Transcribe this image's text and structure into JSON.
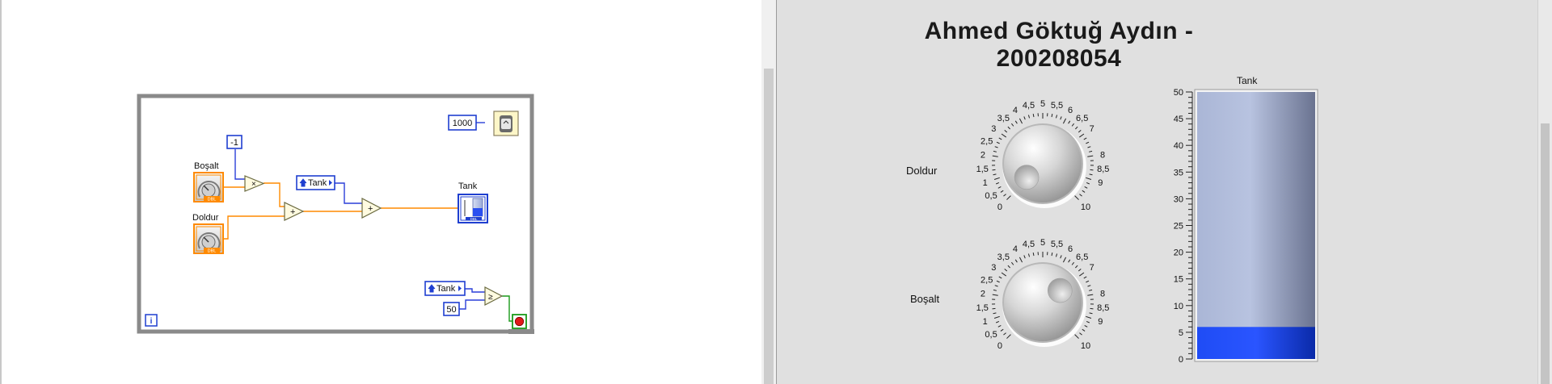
{
  "block_diagram": {
    "constants": {
      "minus_one": "-1",
      "wait_ms": "1000",
      "stop_limit": "50"
    },
    "labels": {
      "bosalt": "Boşalt",
      "doldur": "Doldur",
      "tank": "Tank"
    },
    "local_variables": {
      "tank_local_1": "Tank",
      "tank_local_2": "Tank"
    },
    "knob_terminal_type": "DBL",
    "tank_terminal_type": "DBL",
    "iteration_terminal": "i",
    "operators": {
      "multiply": "×",
      "add": "+",
      "compare": "≥"
    }
  },
  "front_panel": {
    "title": "Ahmed Göktuğ Aydın - 200208054",
    "knobs": [
      {
        "label": "Doldur",
        "ticks": [
          "0",
          "0,5",
          "1",
          "1,5",
          "2",
          "2,5",
          "3",
          "3,5",
          "4",
          "4,5",
          "5",
          "5,5",
          "6",
          "6,5",
          "7",
          "8",
          "8,5",
          "9",
          "10"
        ]
      },
      {
        "label": "Boşalt",
        "ticks": [
          "0",
          "0,5",
          "1",
          "1,5",
          "2",
          "2,5",
          "3",
          "3,5",
          "4",
          "4,5",
          "5",
          "5,5",
          "6",
          "6,5",
          "7",
          "8",
          "8,5",
          "9",
          "10"
        ]
      }
    ],
    "tank": {
      "label": "Tank",
      "scale": [
        "50",
        "45",
        "40",
        "35",
        "30",
        "25",
        "20",
        "15",
        "10",
        "5",
        "0"
      ],
      "min": 0,
      "max": 50,
      "value": 6
    }
  },
  "colors": {
    "wire_orange": "#ff8a00",
    "wire_blue": "#2a3fd8",
    "wire_green": "#1a9a1a",
    "tank_fill": "#1a3fe8",
    "tank_empty": "#b4c0dc",
    "loop_border": "#8a8a8a"
  }
}
